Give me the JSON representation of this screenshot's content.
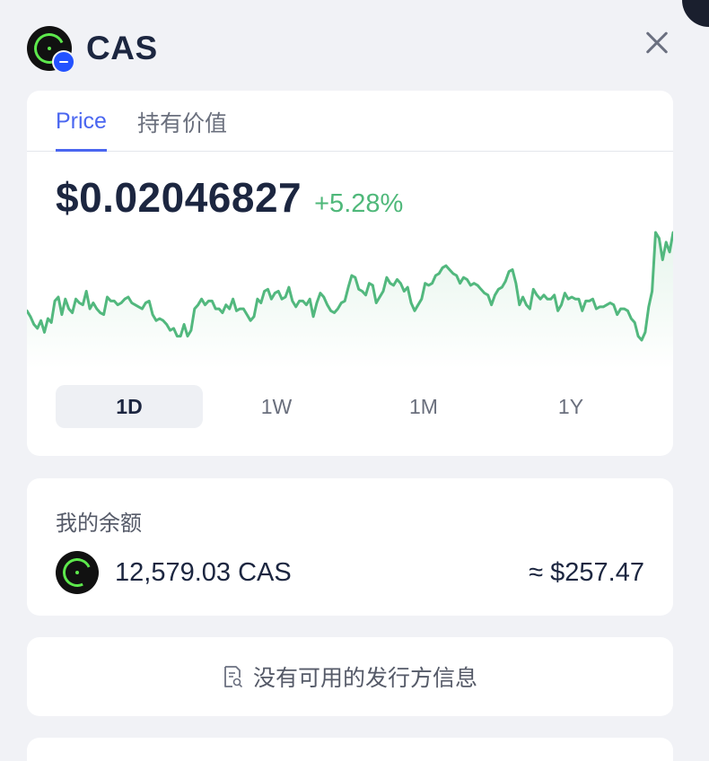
{
  "header": {
    "title": "CAS"
  },
  "tabs": [
    {
      "label": "Price",
      "active": true
    },
    {
      "label": "持有价值",
      "active": false
    }
  ],
  "price": {
    "value": "$0.02046827",
    "change": "+5.28%"
  },
  "ranges": [
    {
      "label": "1D",
      "active": true
    },
    {
      "label": "1W",
      "active": false
    },
    {
      "label": "1M",
      "active": false
    },
    {
      "label": "1Y",
      "active": false
    }
  ],
  "balance": {
    "label": "我的余额",
    "amount": "12,579.03 CAS",
    "usd": "≈ $257.47"
  },
  "issuer": {
    "text": "没有可用的发行方信息"
  },
  "colors": {
    "accent": "#4a66f0",
    "positive": "#4fb87a",
    "token_green": "#5de84c",
    "chain_blue": "#2352ff"
  },
  "chart_data": {
    "type": "line",
    "values": [
      0.02005,
      0.02002,
      0.01998,
      0.01996,
      0.02,
      0.01994,
      0.02001,
      0.01999,
      0.0201,
      0.02012,
      0.02003,
      0.02011,
      0.02006,
      0.02004,
      0.02011,
      0.02009,
      0.02008,
      0.02015,
      0.02006,
      0.02009,
      0.02006,
      0.02004,
      0.02003,
      0.02012,
      0.0201,
      0.0201,
      0.02008,
      0.02009,
      0.02011,
      0.02012,
      0.02009,
      0.02008,
      0.02007,
      0.02006,
      0.02009,
      0.0201,
      0.02003,
      0.02,
      0.02001,
      0.02,
      0.01998,
      0.01995,
      0.01996,
      0.01992,
      0.01992,
      0.01998,
      0.01992,
      0.01995,
      0.02006,
      0.02008,
      0.02011,
      0.02008,
      0.0201,
      0.0201,
      0.02006,
      0.02006,
      0.02004,
      0.02008,
      0.02006,
      0.02011,
      0.02005,
      0.02006,
      0.02006,
      0.02003,
      0.02,
      0.02002,
      0.02011,
      0.02009,
      0.02015,
      0.02016,
      0.02011,
      0.02014,
      0.02015,
      0.02011,
      0.02012,
      0.02017,
      0.0201,
      0.02007,
      0.0201,
      0.0201,
      0.02008,
      0.02011,
      0.02002,
      0.02009,
      0.02014,
      0.02012,
      0.02008,
      0.02005,
      0.02004,
      0.02006,
      0.02009,
      0.0201,
      0.02017,
      0.02023,
      0.02022,
      0.02016,
      0.02015,
      0.02013,
      0.02019,
      0.02018,
      0.02009,
      0.02012,
      0.02015,
      0.02022,
      0.02019,
      0.02018,
      0.02021,
      0.02019,
      0.02015,
      0.02017,
      0.02009,
      0.02005,
      0.02008,
      0.02011,
      0.02019,
      0.02018,
      0.02019,
      0.02023,
      0.02024,
      0.02027,
      0.02028,
      0.02026,
      0.02024,
      0.02023,
      0.02019,
      0.02022,
      0.02021,
      0.02018,
      0.02019,
      0.02018,
      0.02016,
      0.02014,
      0.02013,
      0.02008,
      0.02013,
      0.02016,
      0.02017,
      0.0202,
      0.02025,
      0.02026,
      0.02019,
      0.02008,
      0.02012,
      0.02008,
      0.02006,
      0.02016,
      0.02013,
      0.02011,
      0.02013,
      0.02011,
      0.02011,
      0.02013,
      0.02005,
      0.02008,
      0.02014,
      0.02011,
      0.02012,
      0.02011,
      0.02011,
      0.02005,
      0.0201,
      0.0201,
      0.02011,
      0.02006,
      0.02007,
      0.02007,
      0.02008,
      0.02009,
      0.02008,
      0.02003,
      0.02006,
      0.02006,
      0.02005,
      0.02001,
      0.01999,
      0.01992,
      0.0199,
      0.01994,
      0.02007,
      0.02015,
      0.02045,
      0.02042,
      0.02031,
      0.0204,
      0.02035,
      0.02045
    ]
  }
}
